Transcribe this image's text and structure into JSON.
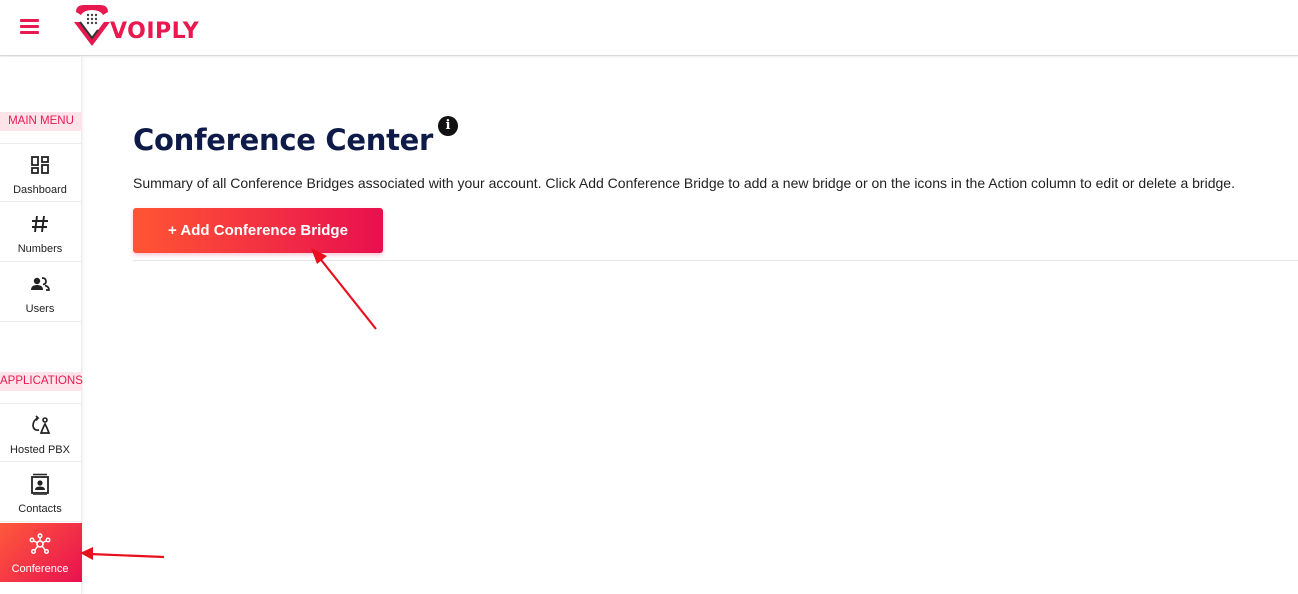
{
  "header": {
    "menu_icon": "hamburger-menu-icon",
    "logo_text": "VOIPLY"
  },
  "sidebar": {
    "main_menu_label": "MAIN MENU",
    "applications_label": "APPLICATIONS",
    "items": [
      {
        "label": "Dashboard",
        "icon": "dashboard-icon"
      },
      {
        "label": "Numbers",
        "icon": "hash-icon"
      },
      {
        "label": "Users",
        "icon": "users-icon"
      },
      {
        "label": "Hosted PBX",
        "icon": "pbx-icon"
      },
      {
        "label": "Contacts",
        "icon": "contacts-icon"
      },
      {
        "label": "Conference",
        "icon": "conference-icon",
        "active": true
      }
    ]
  },
  "main": {
    "title": "Conference Center",
    "info_glyph": "i",
    "description": "Summary of all Conference Bridges associated with your account. Click Add Conference Bridge to add a new bridge or on the icons in the Action column to edit or delete a bridge.",
    "add_button_label": "+ Add Conference Bridge"
  },
  "colors": {
    "accent": "#e8194f",
    "accent_gradient_start": "#ff5533",
    "title": "#0e1a47",
    "annotation_arrow": "#e8101c"
  }
}
